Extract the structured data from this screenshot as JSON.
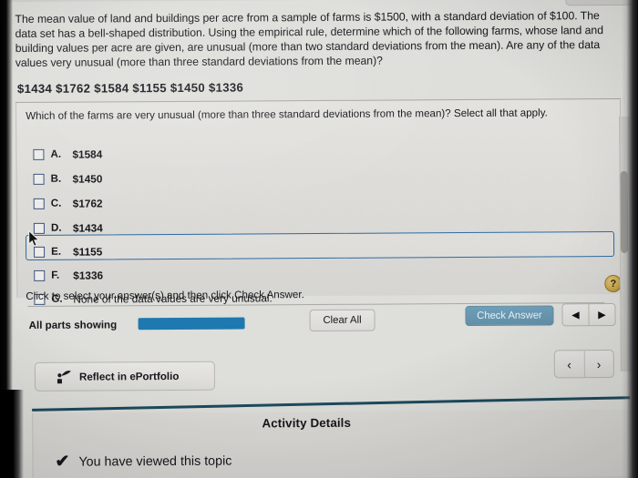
{
  "prompt": {
    "text": "The mean value of land and buildings per acre from a sample of farms is $1500, with a standard deviation of $100. The data set has a bell-shaped distribution. Using the empirical rule, determine which of the following farms, whose land and building values per acre are given, are unusual (more than two standard deviations from the mean). Are any of the data values very unusual (more than three standard deviations from the mean)?",
    "data_values": "$1434  $1762  $1584  $1155  $1450  $1336"
  },
  "question": {
    "text": "Which of the farms are very unusual (more than three standard deviations from the mean)? Select all that apply.",
    "options": [
      {
        "letter": "A.",
        "value": "$1584"
      },
      {
        "letter": "B.",
        "value": "$1450"
      },
      {
        "letter": "C.",
        "value": "$1762"
      },
      {
        "letter": "D.",
        "value": "$1434"
      },
      {
        "letter": "E.",
        "value": "$1155"
      },
      {
        "letter": "F.",
        "value": "$1336"
      },
      {
        "letter": "G.",
        "value": "None of the data values are very unusual."
      }
    ],
    "highlighted_option": "E.",
    "instruction": "Click to select your answer(s) and then click Check Answer."
  },
  "toolbar": {
    "all_parts_label": "All parts showing",
    "clear_all_label": "Clear All",
    "check_answer_label": "Check Answer",
    "help_label": "?",
    "prev_arrow": "◀",
    "next_arrow": "▶",
    "progress_percent": 100,
    "progress_color": "#1d79b0",
    "check_answer_color": "#628fa8"
  },
  "footer": {
    "reflect_label": "Reflect in ePortfolio",
    "nav_prev": "‹",
    "nav_next": "›"
  },
  "details": {
    "title": "Activity Details",
    "viewed_check": "✔",
    "viewed_text": "You have viewed this topic"
  }
}
